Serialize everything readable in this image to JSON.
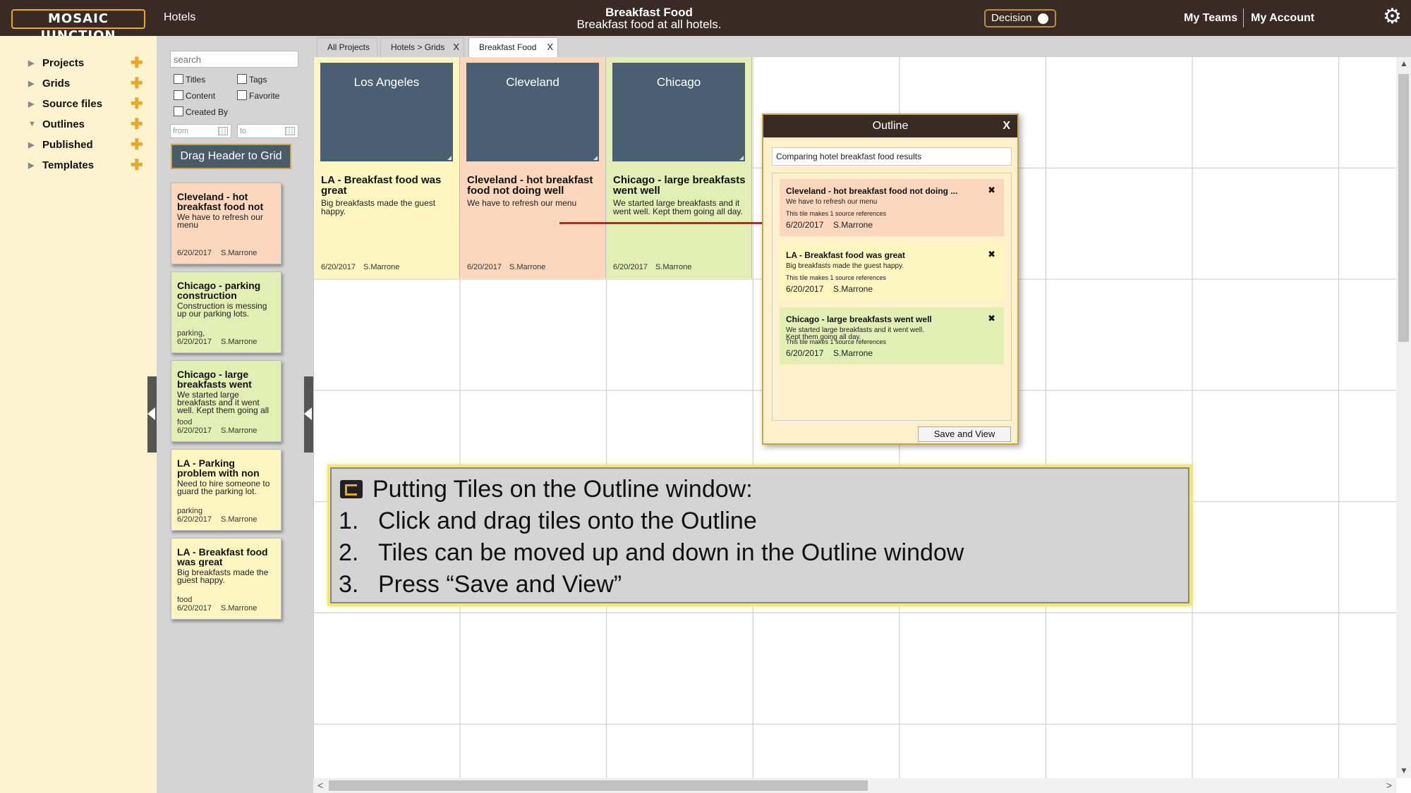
{
  "header": {
    "logo": "MOSAIC JUNCTION",
    "nav_hotels": "Hotels",
    "title": "Breakfast Food",
    "subtitle": "Breakfast food at all hotels.",
    "decision_label": "Decision",
    "my_teams": "My Teams",
    "my_account": "My Account"
  },
  "sidebar": {
    "items": [
      {
        "label": "Projects",
        "expanded": false
      },
      {
        "label": "Grids",
        "expanded": false
      },
      {
        "label": "Source files",
        "expanded": false
      },
      {
        "label": "Outlines",
        "expanded": true
      },
      {
        "label": "Published",
        "expanded": false
      },
      {
        "label": "Templates",
        "expanded": false
      }
    ]
  },
  "filter": {
    "search_placeholder": "search",
    "checkboxes": [
      "Titles",
      "Tags",
      "Content",
      "Favorite",
      "Created By"
    ],
    "from_placeholder": "from",
    "to_placeholder": "to",
    "drag_button": "Drag Header to Grid"
  },
  "panel_tiles": [
    {
      "title": "Cleveland - hot breakfast food not",
      "body": "We have to refresh our menu",
      "tag": "",
      "date": "6/20/2017",
      "author": "S.Marrone",
      "color": "#fbd7bd"
    },
    {
      "title": "Chicago - parking construction",
      "body": "Construction is messing up our parking lots.",
      "tag": "parking,",
      "date": "6/20/2017",
      "author": "S.Marrone",
      "color": "#e3eeb5"
    },
    {
      "title": "Chicago - large breakfasts went",
      "body": "We started large breakfasts and it went well. Kept them going all",
      "tag": "food",
      "date": "6/20/2017",
      "author": "S.Marrone",
      "color": "#e3eeb5"
    },
    {
      "title": "LA - Parking problem with non",
      "body": "Need to hire someone to guard the parking lot.",
      "tag": "parking",
      "date": "6/20/2017",
      "author": "S.Marrone",
      "color": "#fdf6c0"
    },
    {
      "title": "LA - Breakfast food was great",
      "body": "Big breakfasts made the guest happy.",
      "tag": "food",
      "date": "6/20/2017",
      "author": "S.Marrone",
      "color": "#fdf6c0"
    }
  ],
  "tabs": [
    {
      "label": "All Projects",
      "closable": false
    },
    {
      "label": "Hotels > Grids",
      "closable": true
    },
    {
      "label": "Breakfast Food",
      "closable": true,
      "active": true
    }
  ],
  "columns": [
    {
      "header": "Los Angeles",
      "tile_title": "LA - Breakfast food was great",
      "tile_body": "Big breakfasts made the guest happy.",
      "date": "6/20/2017",
      "author": "S.Marrone",
      "color": "#fdf6c0"
    },
    {
      "header": "Cleveland",
      "tile_title": "Cleveland - hot breakfast food not doing well",
      "tile_body": "We have to refresh our menu",
      "date": "6/20/2017",
      "author": "S.Marrone",
      "color": "#fbd7bd"
    },
    {
      "header": "Chicago",
      "tile_title": "Chicago - large breakfasts went well",
      "tile_body": "We started large breakfasts and it went well. Kept them going all day.",
      "date": "6/20/2017",
      "author": "S.Marrone",
      "color": "#e3eeb5"
    }
  ],
  "outline": {
    "title": "Outline",
    "close": "X",
    "name_value": "Comparing hotel breakfast food results",
    "items": [
      {
        "title": "Cleveland - hot breakfast food not doing ...",
        "body": "We have to refresh our menu",
        "refs": "This tile makes 1 source references",
        "date": "6/20/2017",
        "author": "S.Marrone",
        "color": "#fbd7bd"
      },
      {
        "title": "LA - Breakfast food was great",
        "body": "Big breakfasts made the guest happy.",
        "refs": "This tile makes 1 source references",
        "date": "6/20/2017",
        "author": "S.Marrone",
        "color": "#fdf6c0"
      },
      {
        "title": "Chicago - large breakfasts went well",
        "body": "We started large breakfasts and it went well.",
        "body2": "Kept them going all day.",
        "refs": "This tile makes 1 source references",
        "date": "6/20/2017",
        "author": "S.Marrone",
        "color": "#e3eeb5"
      }
    ],
    "save_button": "Save and View"
  },
  "instructions": {
    "heading": "Putting Tiles on the Outline window:",
    "steps": [
      {
        "num": "1.",
        "text": "Click and drag tiles onto the Outline"
      },
      {
        "num": "2.",
        "text": "Tiles can be moved up and down in the Outline window"
      },
      {
        "num": "3.",
        "text": "Press “Save and View”"
      }
    ]
  },
  "colors": {
    "topbar": "#3a2a24",
    "accent": "#e8a82a",
    "sidebar_bg": "#fdf3cf",
    "column_header": "#4a6072",
    "arrow": "#d61a1a"
  }
}
